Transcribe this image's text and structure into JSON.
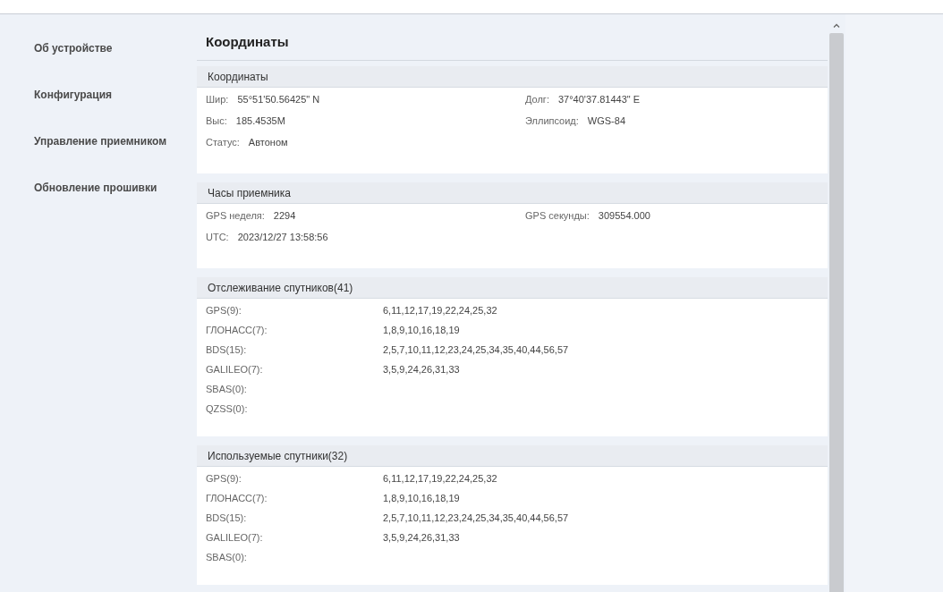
{
  "sidebar": {
    "items": [
      {
        "label": "Об устройстве"
      },
      {
        "label": "Конфигурация"
      },
      {
        "label": "Управление приемником"
      },
      {
        "label": "Обновление прошивки"
      }
    ]
  },
  "page_title": "Координаты",
  "sections": [
    {
      "kind": "pairs",
      "title": "Координаты",
      "fields": [
        {
          "label": "Шир:",
          "value": "55°51'50.56425\" N"
        },
        {
          "label": "Долг:",
          "value": "37°40'37.81443\" E"
        },
        {
          "label": "Выс:",
          "value": "185.4535M"
        },
        {
          "label": "Эллипсоид:",
          "value": "WGS-84"
        },
        {
          "label": "Статус:",
          "value": "Автоном"
        }
      ]
    },
    {
      "kind": "pairs",
      "title": "Часы приемника",
      "fields": [
        {
          "label": "GPS неделя:",
          "value": "2294"
        },
        {
          "label": "GPS секунды:",
          "value": "309554.000"
        },
        {
          "label": "UTC:",
          "value": "2023/12/27 13:58:56"
        }
      ]
    },
    {
      "kind": "list",
      "title": "Отслеживание спутников(41)",
      "fields": [
        {
          "label": "GPS(9):",
          "value": "6,11,12,17,19,22,24,25,32"
        },
        {
          "label": "ГЛОНАСС(7):",
          "value": "1,8,9,10,16,18,19"
        },
        {
          "label": "BDS(15):",
          "value": "2,5,7,10,11,12,23,24,25,34,35,40,44,56,57"
        },
        {
          "label": "GALILEO(7):",
          "value": "3,5,9,24,26,31,33"
        },
        {
          "label": "SBAS(0):"
        },
        {
          "label": "QZSS(0):"
        }
      ]
    },
    {
      "kind": "list",
      "title": "Используемые спутники(32)",
      "fields": [
        {
          "label": "GPS(9):",
          "value": "6,11,12,17,19,22,24,25,32"
        },
        {
          "label": "ГЛОНАСС(7):",
          "value": "1,8,9,10,16,18,19"
        },
        {
          "label": "BDS(15):",
          "value": "2,5,7,10,11,12,23,24,25,34,35,40,44,56,57"
        },
        {
          "label": "GALILEO(7):",
          "value": "3,5,9,24,26,31,33"
        },
        {
          "label": "SBAS(0):"
        }
      ]
    }
  ]
}
